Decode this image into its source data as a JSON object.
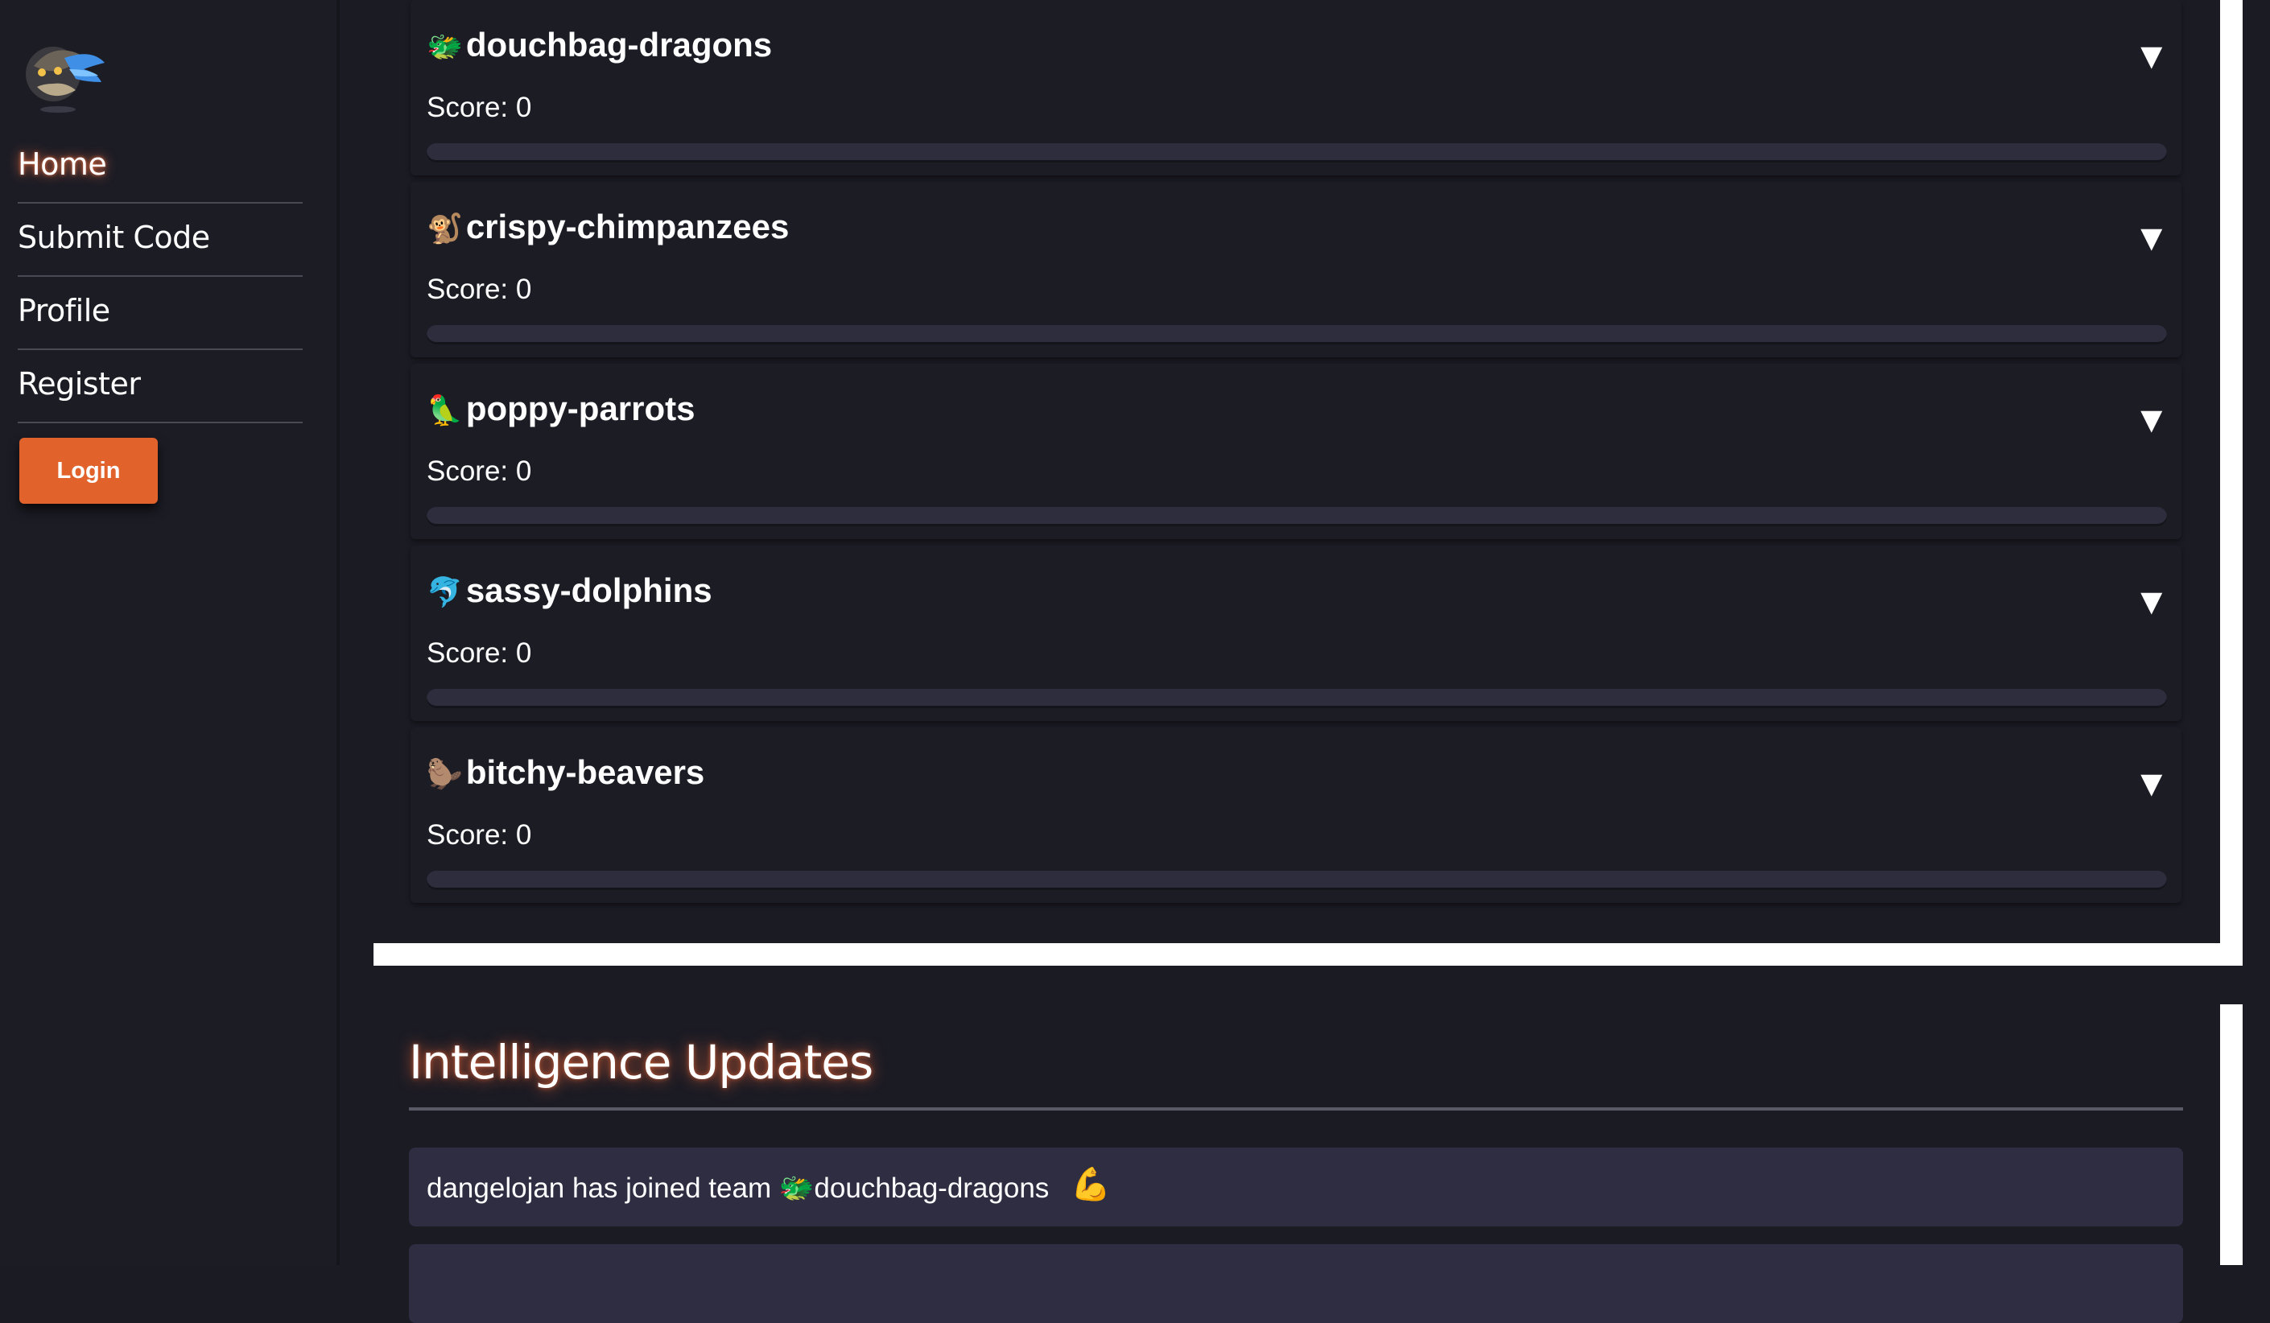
{
  "sidebar": {
    "logo_icon": "dragon-sphere-logo",
    "nav": [
      {
        "label": "Home",
        "active": true
      },
      {
        "label": "Submit Code",
        "active": false
      },
      {
        "label": "Profile",
        "active": false
      },
      {
        "label": "Register",
        "active": false
      }
    ],
    "login_label": "Login",
    "login_color": "#e2622c"
  },
  "teams": [
    {
      "emoji": "🐲",
      "name": "douchbag-dragons",
      "score_text": "Score: 0",
      "score": 0,
      "toggle": "▼"
    },
    {
      "emoji": "🐒",
      "name": "crispy-chimpanzees",
      "score_text": "Score: 0",
      "score": 0,
      "toggle": "▼"
    },
    {
      "emoji": "🦜",
      "name": "poppy-parrots",
      "score_text": "Score: 0",
      "score": 0,
      "toggle": "▼"
    },
    {
      "emoji": "🐬",
      "name": "sassy-dolphins",
      "score_text": "Score: 0",
      "score": 0,
      "toggle": "▼"
    },
    {
      "emoji": "🦫",
      "name": "bitchy-beavers",
      "score_text": "Score: 0",
      "score": 0,
      "toggle": "▼"
    }
  ],
  "intel": {
    "title": "Intelligence Updates",
    "updates": [
      {
        "text": "dangelojan has joined team 🐲douchbag-dragons",
        "icon": "💪"
      }
    ]
  },
  "colors": {
    "background": "#1b1b24",
    "accent": "#e2622c",
    "bar_track": "#2d2d3d",
    "update_bg": "#2e2d42"
  }
}
